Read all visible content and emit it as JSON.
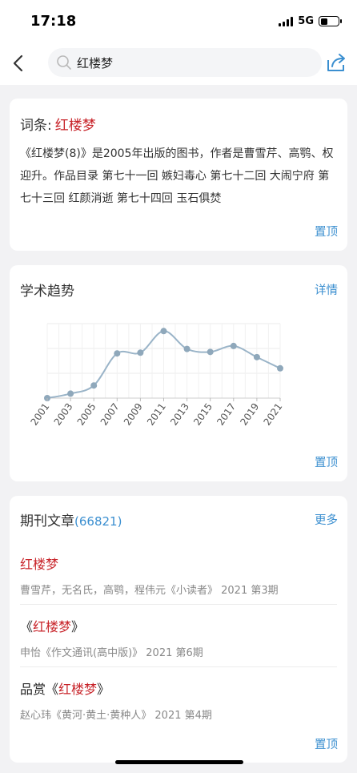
{
  "status_bar": {
    "time": "17:18",
    "network": "5G",
    "battery_level": 0.4
  },
  "search": {
    "value": "红楼梦"
  },
  "entry_card": {
    "label": "词条:",
    "keyword": "红楼梦",
    "description": "《红楼梦(8)》是2005年出版的图书，作者是曹雪芹、高鹗、权迎升。作品目录 第七十一回 嫉妇毒心 第七十二回 大闹宁府 第七十三回 红颜消逝 第七十四回 玉石俱焚",
    "top_label": "置顶"
  },
  "trend_card": {
    "title": "学术趋势",
    "detail_label": "详情",
    "top_label": "置顶"
  },
  "chart_data": {
    "type": "line",
    "x": [
      2001,
      2002,
      2003,
      2004,
      2005,
      2006,
      2007,
      2008,
      2009,
      2010,
      2011,
      2012,
      2013,
      2014,
      2015,
      2016,
      2017,
      2018,
      2019,
      2020,
      2021
    ],
    "x_tick_labels": [
      "2001",
      "2003",
      "2005",
      "2007",
      "2009",
      "2011",
      "2013",
      "2015",
      "2017",
      "2019",
      "2021"
    ],
    "values": [
      0,
      null,
      6,
      null,
      17,
      null,
      60,
      null,
      61,
      null,
      90,
      null,
      66,
      null,
      62,
      null,
      70,
      null,
      55,
      null,
      40
    ],
    "ylim": [
      0,
      100
    ],
    "grid": true,
    "line_color": "#9ab4c8",
    "point_color": "#8fa8bb"
  },
  "journal_card": {
    "title": "期刊文章",
    "count": "(66821)",
    "more_label": "更多",
    "articles": [
      {
        "prefix": "",
        "highlight": "红楼梦",
        "suffix": "",
        "meta": "曹雪芹，无名氏，高鹗，程伟元《小读者》 2021 第3期"
      },
      {
        "prefix": "《",
        "highlight": "红楼梦",
        "suffix": "》",
        "meta": "申怡《作文通讯(高中版)》 2021 第6期"
      },
      {
        "prefix": "品赏《",
        "highlight": "红楼梦",
        "suffix": "》",
        "meta": "赵心玮《黄河·黄土·黄种人》 2021 第4期"
      }
    ],
    "top_label": "置顶"
  },
  "colors": {
    "accent": "#3b8fd0",
    "keyword": "#c8242a",
    "background": "#f2f2f4"
  }
}
